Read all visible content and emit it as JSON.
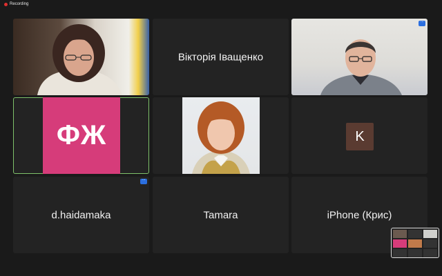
{
  "recording": {
    "label": "Recording"
  },
  "participants": [
    {
      "name": "",
      "type": "video"
    },
    {
      "name": "Вікторія Іващенко",
      "type": "name"
    },
    {
      "name": "",
      "type": "video"
    },
    {
      "name": "",
      "type": "logo",
      "logo_text": "ФЖ"
    },
    {
      "name": "",
      "type": "photo"
    },
    {
      "name": "",
      "type": "avatar",
      "initial": "K"
    },
    {
      "name": "d.haidamaka",
      "type": "name"
    },
    {
      "name": "Tamara",
      "type": "name"
    },
    {
      "name": "iPhone (Крис)",
      "type": "name"
    }
  ],
  "colors": {
    "background": "#1a1a1a",
    "tile": "#232323",
    "active_border": "#7fc26b",
    "logo_bg": "#d63c7a",
    "recording_dot": "#e02f2f"
  },
  "icons": [
    "more-options-icon",
    "recording-dot-icon"
  ]
}
